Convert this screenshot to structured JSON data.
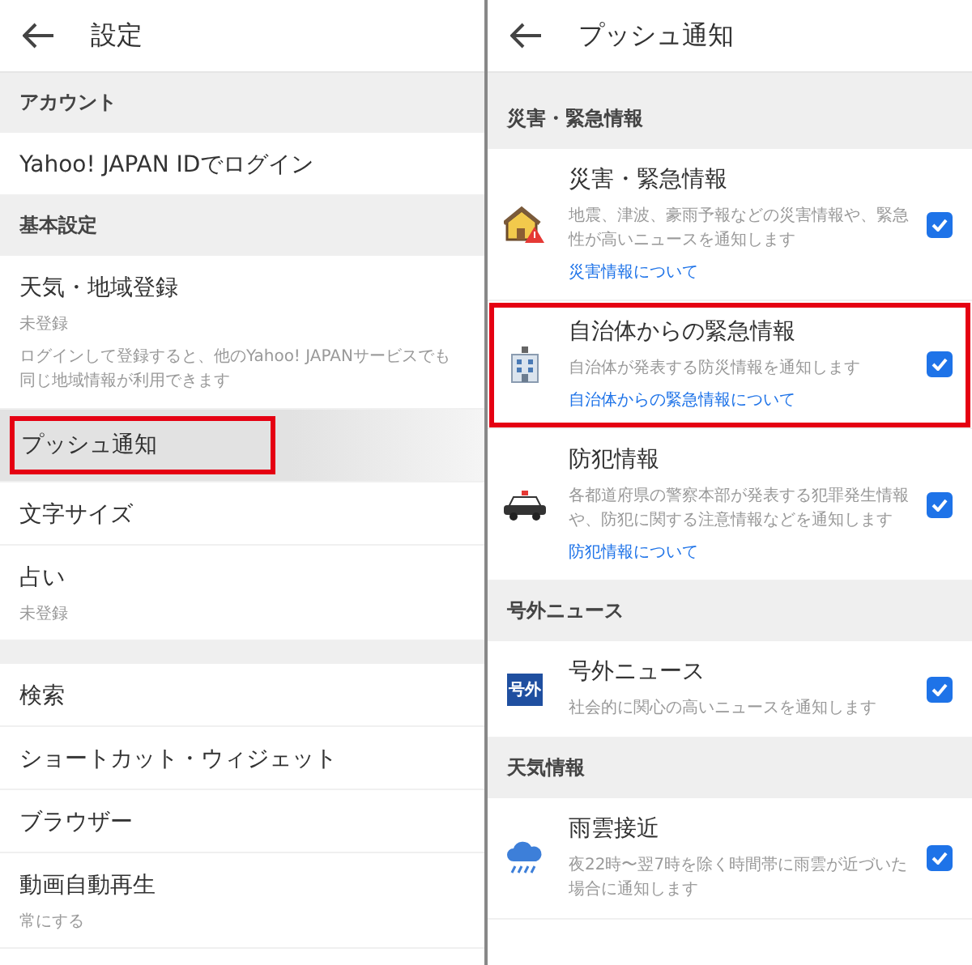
{
  "left": {
    "title": "設定",
    "rows": [
      {
        "kind": "section",
        "label": "アカウント"
      },
      {
        "kind": "item",
        "label": "Yahoo! JAPAN IDでログイン",
        "highlighted": false
      },
      {
        "kind": "section",
        "label": "基本設定"
      },
      {
        "kind": "item",
        "label": "天気・地域登録",
        "sub": "未登録",
        "description": "ログインして登録すると、他のYahoo! JAPANサービスでも同じ地域情報が利用できます",
        "highlighted": false
      },
      {
        "kind": "item",
        "label": "プッシュ通知",
        "highlighted": true
      },
      {
        "kind": "item",
        "label": "文字サイズ",
        "highlighted": false
      },
      {
        "kind": "item",
        "label": "占い",
        "sub": "未登録",
        "highlighted": false
      },
      {
        "kind": "spacer"
      },
      {
        "kind": "item",
        "label": "検索",
        "highlighted": false
      },
      {
        "kind": "item",
        "label": "ショートカット・ウィジェット",
        "highlighted": false
      },
      {
        "kind": "item",
        "label": "ブラウザー",
        "highlighted": false
      },
      {
        "kind": "item",
        "label": "動画自動再生",
        "sub": "常にする",
        "highlighted": false
      }
    ]
  },
  "right": {
    "title": "プッシュ通知",
    "groups": [
      {
        "heading": "災害・緊急情報",
        "items": [
          {
            "title": "災害・緊急情報",
            "description": "地震、津波、豪雨予報などの災害情報や、緊急性が高いニュースを通知します",
            "link": "災害情報について",
            "checked": true,
            "highlighted": false
          },
          {
            "title": "自治体からの緊急情報",
            "description": "自治体が発表する防災情報を通知します",
            "link": "自治体からの緊急情報について",
            "checked": true,
            "highlighted": true
          },
          {
            "title": "防犯情報",
            "description": "各都道府県の警察本部が発表する犯罪発生情報や、防犯に関する注意情報などを通知します",
            "link": "防犯情報について",
            "checked": true,
            "highlighted": false
          }
        ]
      },
      {
        "heading": "号外ニュース",
        "items": [
          {
            "title": "号外ニュース",
            "description": "社会的に関心の高いニュースを通知します",
            "icon_text": "号外",
            "checked": true,
            "highlighted": false
          }
        ]
      },
      {
        "heading": "天気情報",
        "items": [
          {
            "title": "雨雲接近",
            "description": "夜22時〜翌7時を除く時間帯に雨雲が近づいた場合に通知します",
            "checked": true,
            "highlighted": false
          }
        ]
      }
    ]
  }
}
